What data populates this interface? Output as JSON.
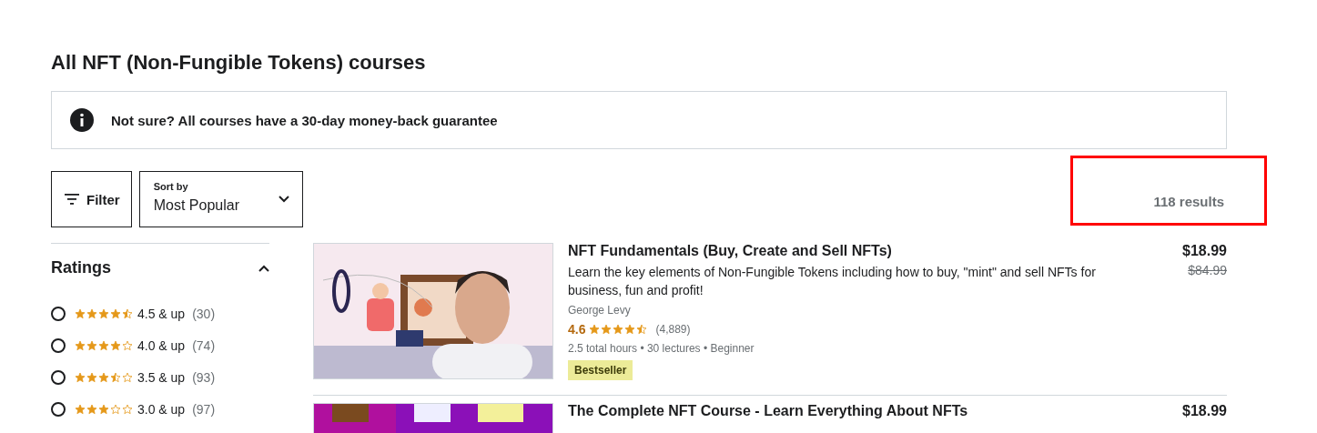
{
  "page_title": "All NFT (Non-Fungible Tokens) courses",
  "notice": {
    "text": "Not sure? All courses have a 30-day money-back guarantee"
  },
  "filter_button": {
    "label": "Filter"
  },
  "sort": {
    "label": "Sort by",
    "value": "Most Popular"
  },
  "results": {
    "text": "118 results",
    "highlighted": true
  },
  "ratings_filter": {
    "title": "Ratings",
    "expanded": true,
    "options": [
      {
        "stars": 4.5,
        "label": "4.5 & up",
        "count": "(30)",
        "selected": false
      },
      {
        "stars": 4,
        "label": "4.0 & up",
        "count": "(74)",
        "selected": false
      },
      {
        "stars": 3.5,
        "label": "3.5 & up",
        "count": "(93)",
        "selected": false
      },
      {
        "stars": 3,
        "label": "3.0 & up",
        "count": "(97)",
        "selected": false
      }
    ]
  },
  "courses": [
    {
      "title": "NFT Fundamentals (Buy, Create and Sell NFTs)",
      "description": "Learn the key elements of Non-Fungible Tokens including how to buy, \"mint\" and sell NFTs for business, fun and profit!",
      "instructor": "George Levy",
      "rating": "4.6",
      "stars": 4.5,
      "reviews": "(4,889)",
      "details": "2.5 total hours • 30 lectures • Beginner",
      "badge": "Bestseller",
      "price": "$18.99",
      "original_price": "$84.99"
    },
    {
      "title": "The Complete NFT Course - Learn Everything About NFTs",
      "price": "$18.99"
    }
  ]
}
